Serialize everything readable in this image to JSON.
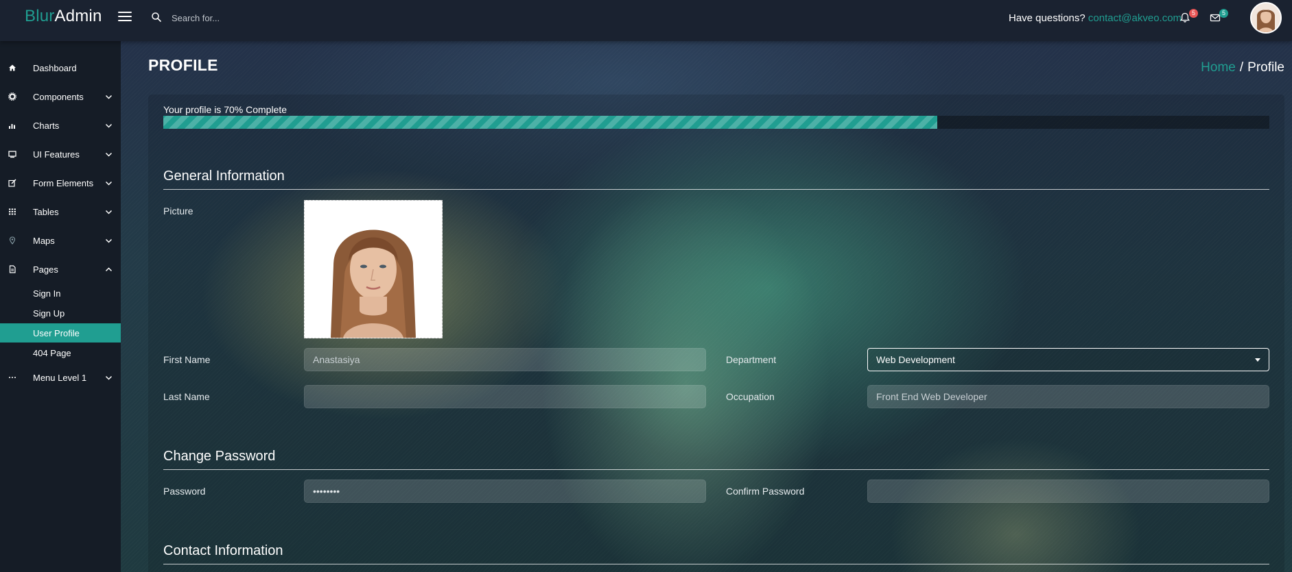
{
  "app": {
    "brand_part1": "Blur",
    "brand_part2": "Admin"
  },
  "header": {
    "search_placeholder": "Search for...",
    "questions_text": "Have questions?",
    "contact_email": "contact@akveo.com",
    "notifications_count": "5",
    "messages_count": "5"
  },
  "sidebar": {
    "items": [
      {
        "label": "Dashboard",
        "icon": "home-icon",
        "has_chevron": false
      },
      {
        "label": "Components",
        "icon": "gear-icon",
        "has_chevron": true
      },
      {
        "label": "Charts",
        "icon": "bar-chart-icon",
        "has_chevron": true
      },
      {
        "label": "UI Features",
        "icon": "monitor-icon",
        "has_chevron": true
      },
      {
        "label": "Form Elements",
        "icon": "edit-icon",
        "has_chevron": true
      },
      {
        "label": "Tables",
        "icon": "grid-icon",
        "has_chevron": true
      },
      {
        "label": "Maps",
        "icon": "map-pin-icon",
        "has_chevron": true
      },
      {
        "label": "Pages",
        "icon": "file-icon",
        "has_chevron": true,
        "expanded": true
      }
    ],
    "pages_subitems": [
      {
        "label": "Sign In",
        "active": false
      },
      {
        "label": "Sign Up",
        "active": false
      },
      {
        "label": "User Profile",
        "active": true
      },
      {
        "label": "404 Page",
        "active": false
      }
    ],
    "menu_level": {
      "label": "Menu Level 1",
      "icon": "ellipsis-icon"
    }
  },
  "page": {
    "title": "PROFILE",
    "breadcrumb": {
      "home": "Home",
      "separator": "/",
      "current": "Profile"
    }
  },
  "progress": {
    "label": "Your profile is 70% Complete",
    "percent": 70
  },
  "general": {
    "section_title": "General Information",
    "picture_label": "Picture",
    "first_name_label": "First Name",
    "first_name_value": "Anastasiya",
    "last_name_label": "Last Name",
    "last_name_value": "",
    "department_label": "Department",
    "department_value": "Web Development",
    "occupation_label": "Occupation",
    "occupation_value": "Front End Web Developer"
  },
  "password": {
    "section_title": "Change Password",
    "password_label": "Password",
    "password_value": "••••••••",
    "confirm_label": "Confirm Password",
    "confirm_value": ""
  },
  "contact": {
    "section_title": "Contact Information"
  },
  "colors": {
    "accent": "#209e91",
    "notification_badge": "#e85656",
    "message_badge": "#209e91",
    "sidebar_bg": "#151c26",
    "topbar_bg": "#1a2230"
  }
}
